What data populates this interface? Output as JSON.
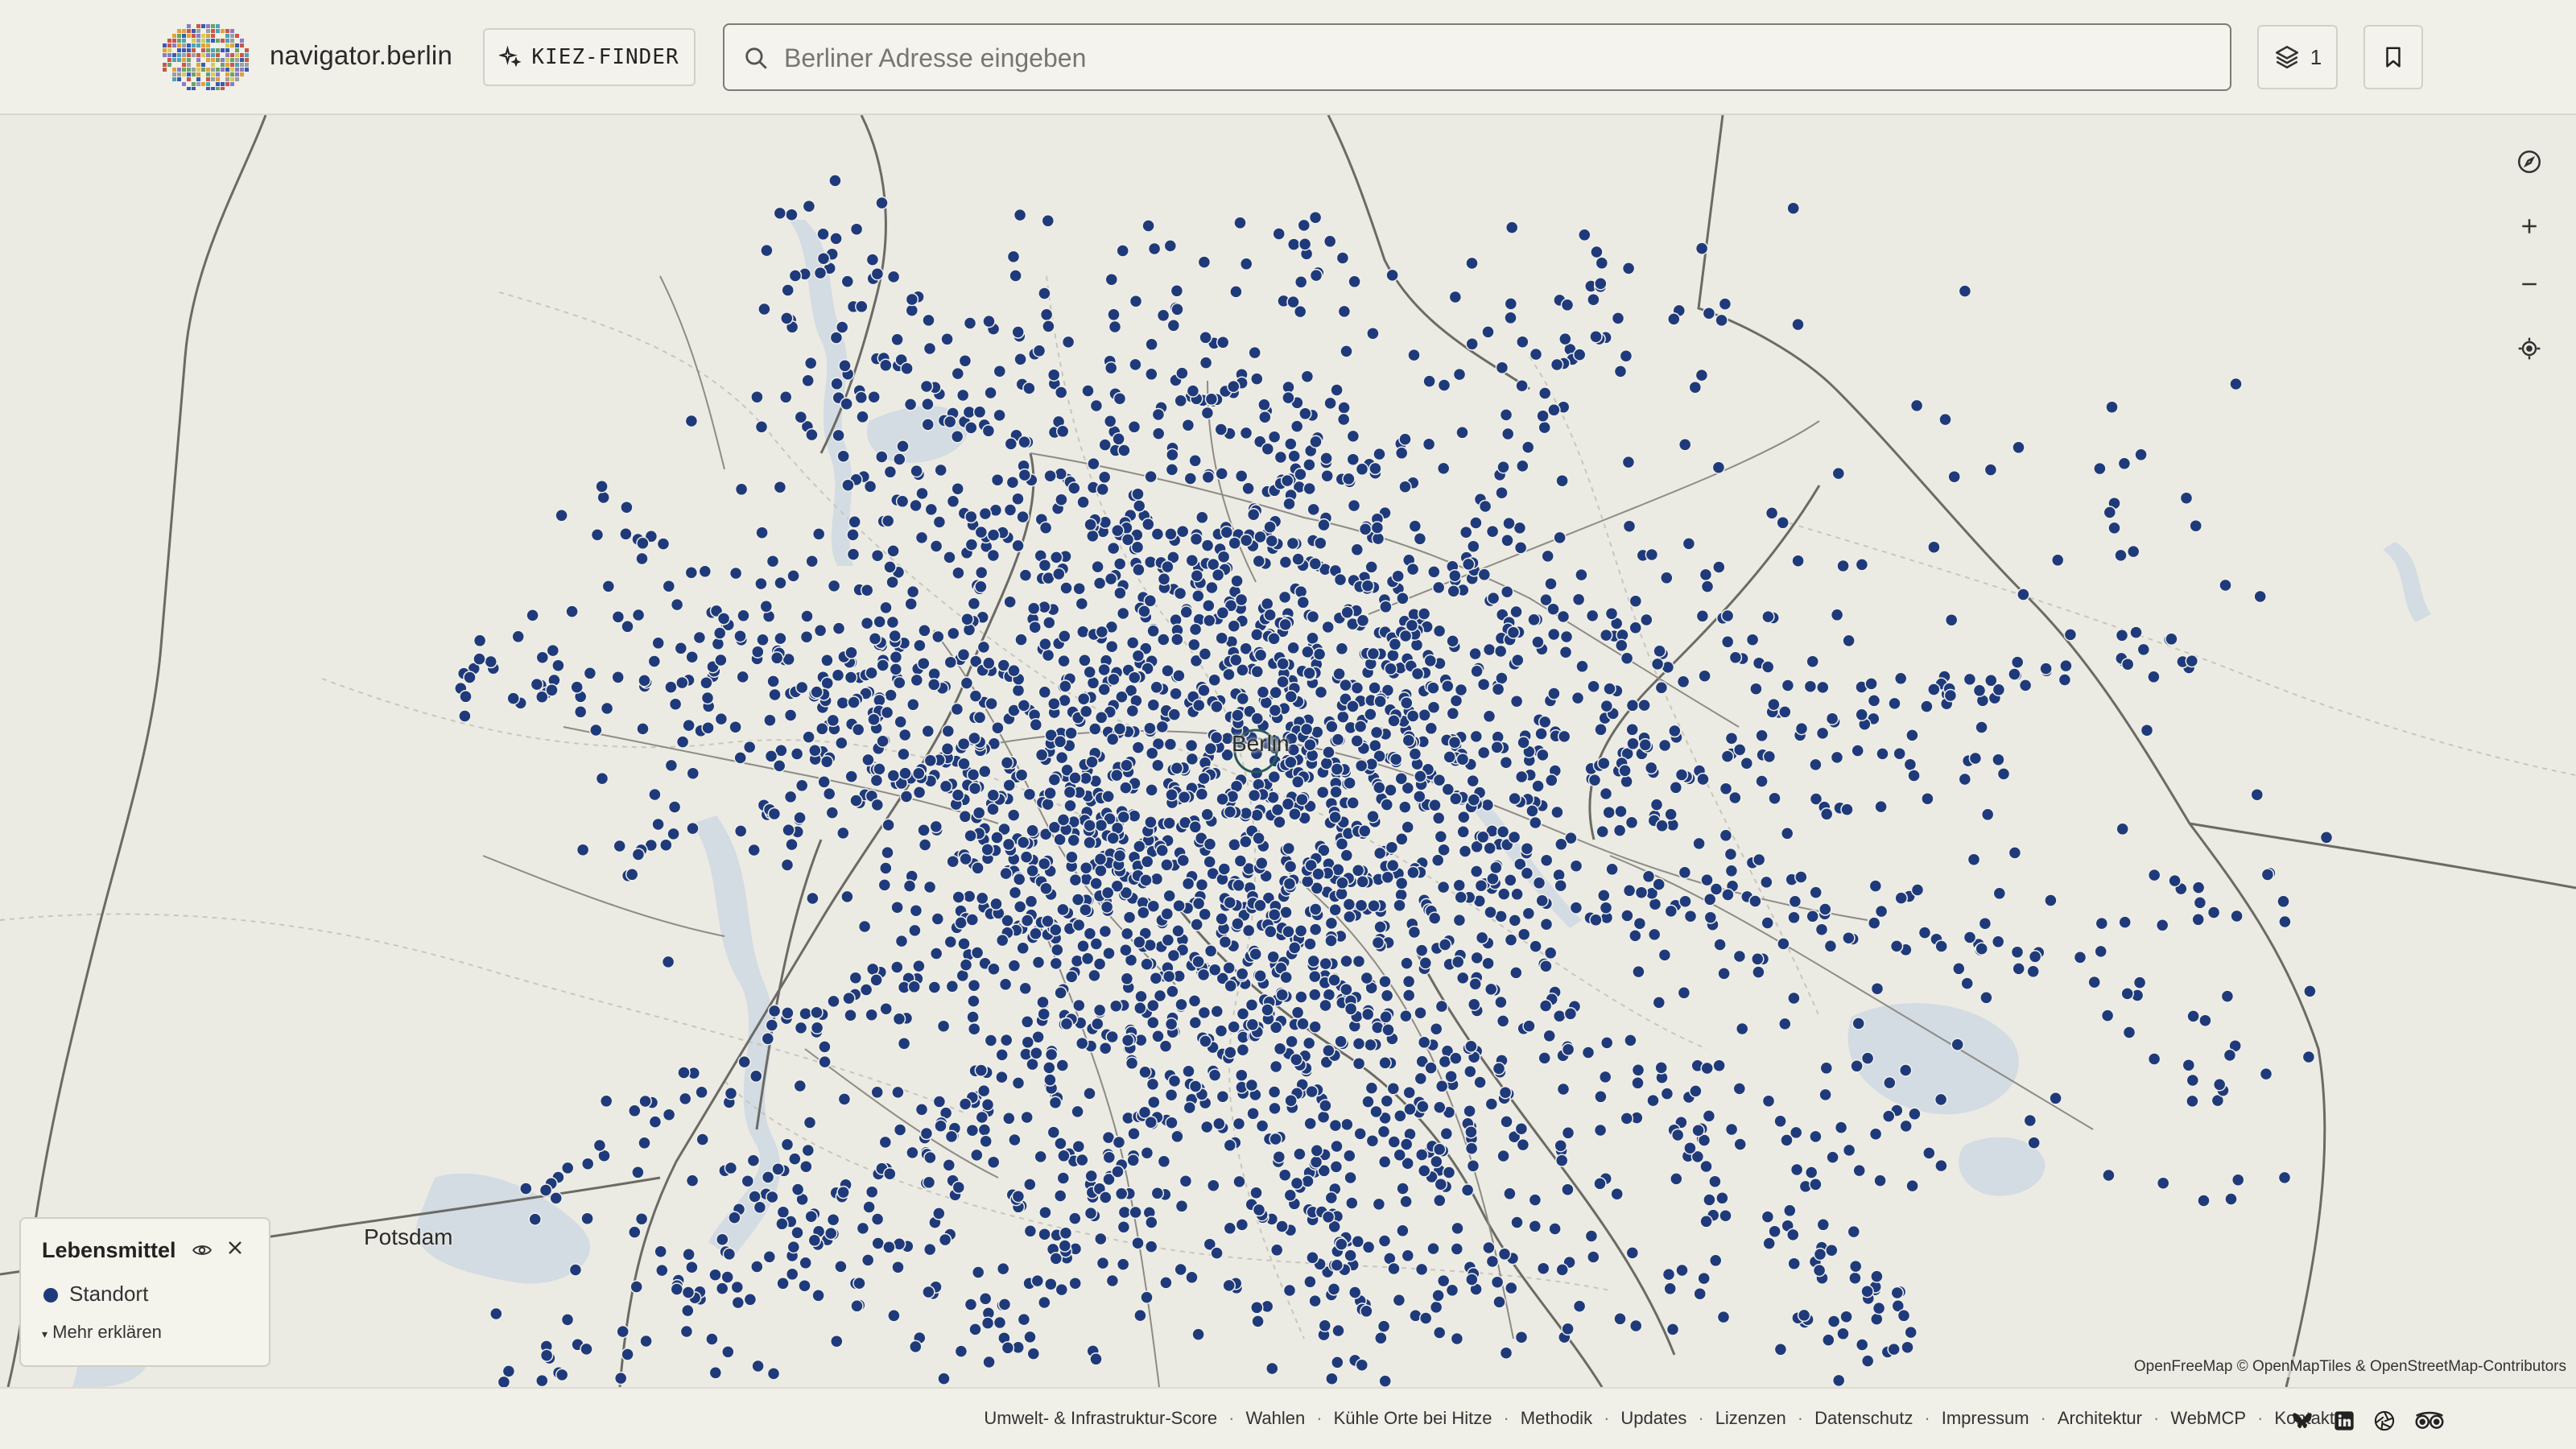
{
  "header": {
    "site_name": "navigator.berlin",
    "kiez_button": "KIEZ-FINDER",
    "search_placeholder": "Berliner Adresse eingeben",
    "layers_count": "1"
  },
  "map": {
    "labels": {
      "city": "Berlin",
      "potsdam": "Potsdam"
    },
    "marker_color": "#1f3a7a",
    "attribution": "OpenFreeMap © OpenMapTiles & OpenStreetMap-Contributors"
  },
  "legend": {
    "title": "Lebensmittel",
    "item": "Standort",
    "more": "Mehr erklären"
  },
  "footer": {
    "links": [
      "Umwelt- & Infrastruktur-Score",
      "Wahlen",
      "Kühle Orte bei Hitze",
      "Methodik",
      "Updates",
      "Lizenzen",
      "Datenschutz",
      "Impressum",
      "Architektur",
      "WebMCP",
      "Kontakt"
    ],
    "separator": "·"
  }
}
